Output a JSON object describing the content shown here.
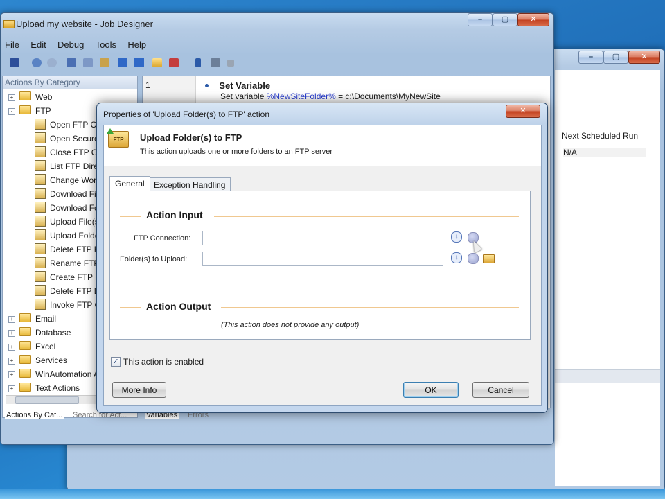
{
  "main_window": {
    "title": "Upload my website - Job Designer",
    "menu": [
      "File",
      "Edit",
      "Debug",
      "Tools",
      "Help"
    ]
  },
  "left_panel": {
    "header": "Actions By Category",
    "tree": [
      {
        "type": "folder",
        "label": "Web",
        "expander": "+"
      },
      {
        "type": "folder",
        "label": "FTP",
        "expander": "-"
      },
      {
        "type": "action",
        "label": "Open FTP Co"
      },
      {
        "type": "action",
        "label": "Open Secure"
      },
      {
        "type": "action",
        "label": "Close FTP Co"
      },
      {
        "type": "action",
        "label": "List FTP Dire"
      },
      {
        "type": "action",
        "label": "Change Work"
      },
      {
        "type": "action",
        "label": "Download Fil"
      },
      {
        "type": "action",
        "label": "Download Fo"
      },
      {
        "type": "action",
        "label": "Upload File(s"
      },
      {
        "type": "action",
        "label": "Upload Folde"
      },
      {
        "type": "action",
        "label": "Delete FTP F"
      },
      {
        "type": "action",
        "label": "Rename FTP"
      },
      {
        "type": "action",
        "label": "Create FTP D"
      },
      {
        "type": "action",
        "label": "Delete FTP D"
      },
      {
        "type": "action",
        "label": "Invoke FTP C"
      },
      {
        "type": "folder",
        "label": "Email",
        "expander": "+"
      },
      {
        "type": "folder",
        "label": "Database",
        "expander": "+"
      },
      {
        "type": "folder",
        "label": "Excel",
        "expander": "+"
      },
      {
        "type": "folder",
        "label": "Services",
        "expander": "+"
      },
      {
        "type": "folder",
        "label": "WinAutomation A",
        "expander": "+"
      },
      {
        "type": "folder",
        "label": "Text Actions",
        "expander": "+"
      }
    ],
    "bottom_tabs": [
      "Actions By Cat...",
      "Search for Act..."
    ]
  },
  "editor": {
    "line_number": "1",
    "action_title": "Set Variable",
    "action_detail_prefix": "Set variable ",
    "action_variable": "%NewSiteFolder%",
    "action_detail_suffix": " = c:\\Documents\\MyNewSite",
    "bottom_tabs": [
      "Variables",
      "Errors"
    ]
  },
  "background_window": {
    "column_header": "Next Scheduled Run",
    "value": "N/A"
  },
  "dialog": {
    "title": "Properties of 'Upload Folder(s) to FTP' action",
    "header_title": "Upload Folder(s) to FTP",
    "header_desc": "This action uploads one or more folders to an FTP server",
    "header_icon_text": "FTP",
    "tabs": [
      "General",
      "Exception Handling"
    ],
    "input_section": "Action Input",
    "fields": [
      {
        "label": "FTP Connection:",
        "value": ""
      },
      {
        "label": "Folder(s) to Upload:",
        "value": ""
      }
    ],
    "output_section": "Action Output",
    "output_note": "(This action does not provide any output)",
    "enabled_label": "This action is enabled",
    "enabled_checked": true,
    "buttons": {
      "more_info": "More Info",
      "ok": "OK",
      "cancel": "Cancel"
    }
  },
  "colors": {
    "desktop": "#2a7fc9",
    "variable_text": "#2b3fd1",
    "section_line": "#f0c890"
  }
}
